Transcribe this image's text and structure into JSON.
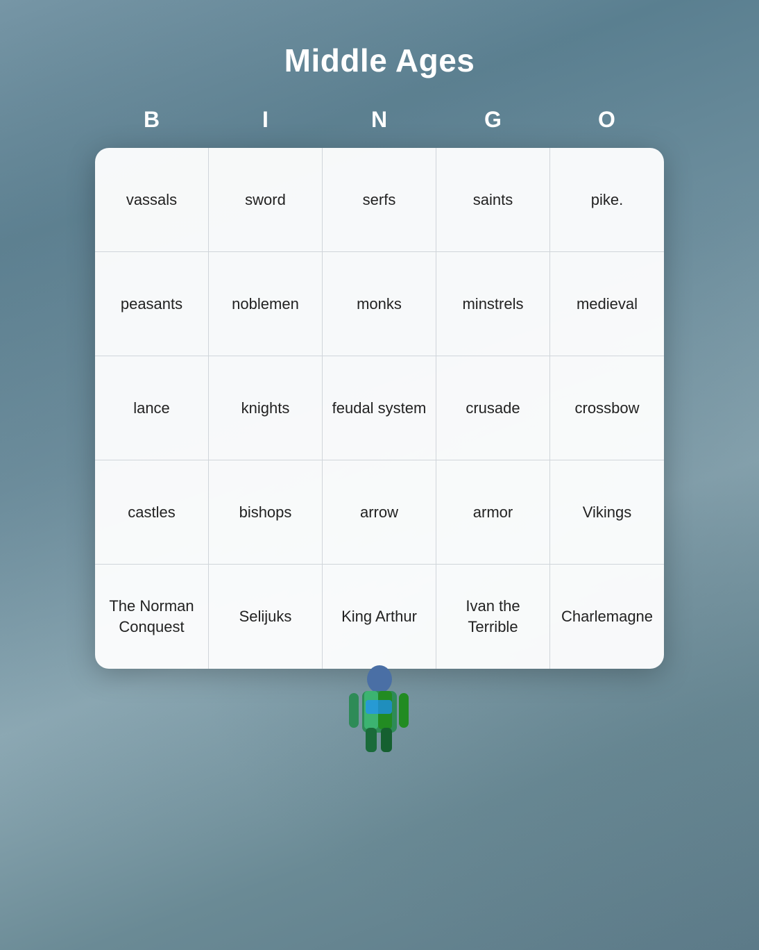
{
  "title": "Middle Ages",
  "bingo_letters": [
    "B",
    "I",
    "N",
    "G",
    "O"
  ],
  "cells": [
    "vassals",
    "sword",
    "serfs",
    "saints",
    "pike.",
    "peasants",
    "noblemen",
    "monks",
    "minstrels",
    "medieval",
    "lance",
    "knights",
    "feudal system",
    "crusade",
    "crossbow",
    "castles",
    "bishops",
    "arrow",
    "armor",
    "Vikings",
    "The Norman Conquest",
    "Selijuks",
    "King Arthur",
    "Ivan the Terrible",
    "Charlemagne"
  ]
}
